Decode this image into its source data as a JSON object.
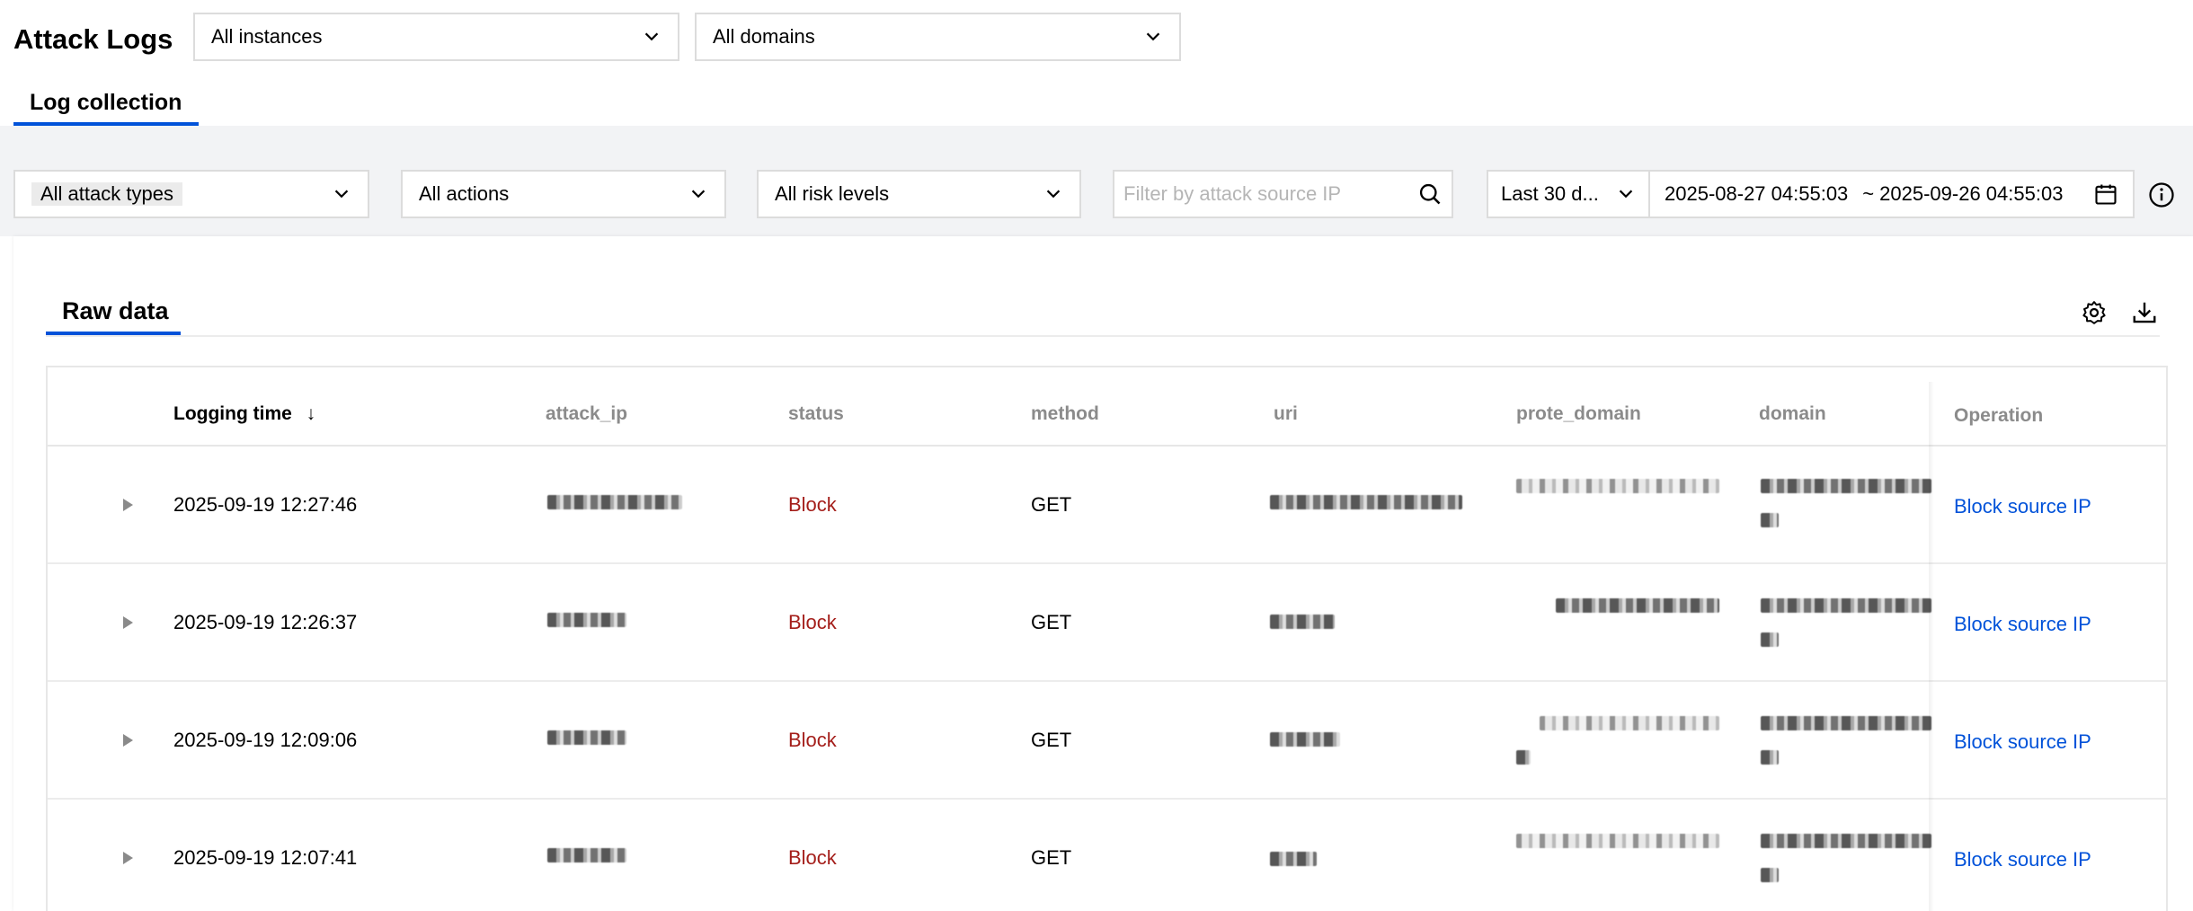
{
  "header": {
    "title": "Attack Logs",
    "instance_select": "All instances",
    "domain_select": "All domains",
    "tab": "Log collection"
  },
  "filters": {
    "attack_type": "All attack types",
    "action": "All actions",
    "risk_level": "All risk levels",
    "ip_placeholder": "Filter by attack source IP",
    "time_range": "Last 30 d...",
    "date_start": "2025-08-27 04:55:03",
    "date_sep": "~",
    "date_end": "2025-09-26 04:55:03"
  },
  "panel": {
    "tab": "Raw data"
  },
  "table": {
    "columns": {
      "logging_time": "Logging time",
      "sort_indicator": "↓",
      "attack_ip": "attack_ip",
      "status": "status",
      "method": "method",
      "uri": "uri",
      "prote_domain": "prote_domain",
      "domain": "domain",
      "operation": "Operation"
    },
    "rows": [
      {
        "time": "2025-09-19 12:27:46",
        "status": "Block",
        "method": "GET",
        "operation": "Block source IP"
      },
      {
        "time": "2025-09-19 12:26:37",
        "status": "Block",
        "method": "GET",
        "operation": "Block source IP"
      },
      {
        "time": "2025-09-19 12:09:06",
        "status": "Block",
        "method": "GET",
        "operation": "Block source IP"
      },
      {
        "time": "2025-09-19 12:07:41",
        "status": "Block",
        "method": "GET",
        "operation": "Block source IP"
      }
    ]
  },
  "colors": {
    "accent": "#0052d9",
    "block_status": "#a41e1a",
    "filter_bar_bg": "#f2f3f5"
  },
  "icons": [
    "chevron-down-icon",
    "search-icon",
    "calendar-icon",
    "info-icon",
    "gear-icon",
    "download-icon",
    "sort-down-icon",
    "expand-caret-icon"
  ]
}
